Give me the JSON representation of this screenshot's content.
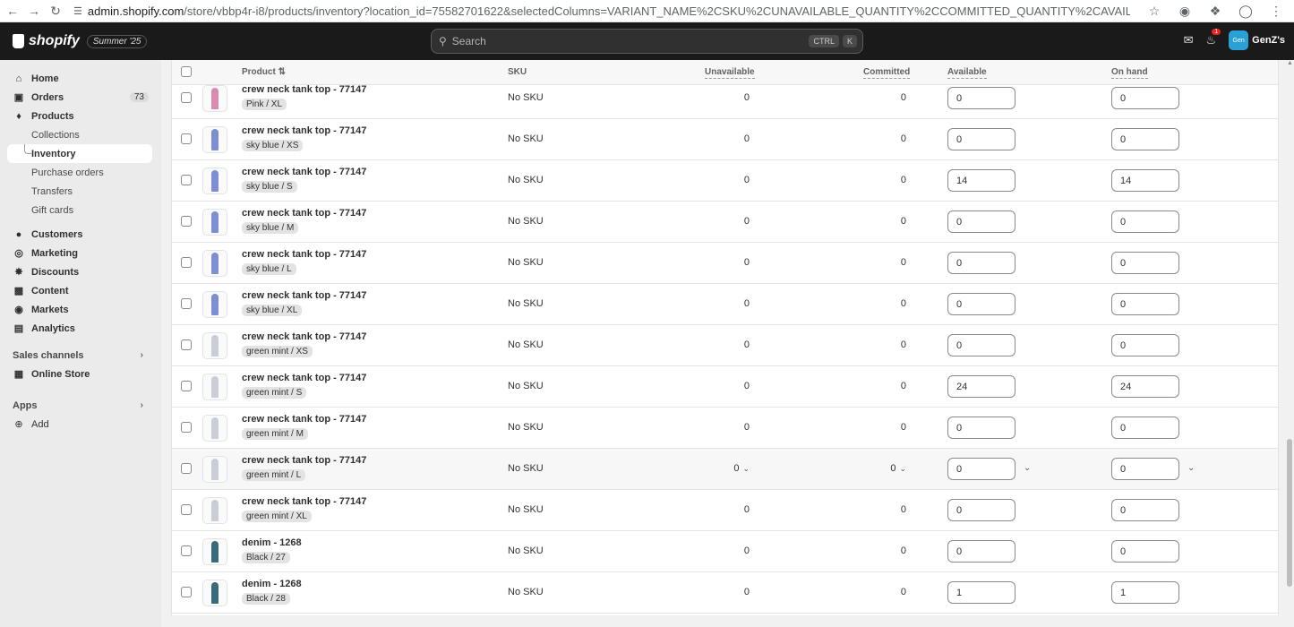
{
  "browser": {
    "url_host": "admin.shopify.com",
    "url_path": "/store/vbbp4r-i8/products/inventory?location_id=75582701622&selectedColumns=VARIANT_NAME%2CSKU%2CUNAVAILABLE_QUANTITY%2CCOMMITTED_QUANTITY%2CAVAILABLE_QUANTITY%2CON_HAND_QUANTITY..."
  },
  "topbar": {
    "brand": "shopify",
    "edition": "Summer '25",
    "search_placeholder": "Search",
    "shortcut_key1": "CTRL",
    "shortcut_key2": "K",
    "notification_count": "1",
    "avatar_initials": "Gen",
    "store_name": "GenZ's"
  },
  "sidebar": {
    "home": "Home",
    "orders": "Orders",
    "orders_count": "73",
    "products": "Products",
    "collections": "Collections",
    "inventory": "Inventory",
    "purchase_orders": "Purchase orders",
    "transfers": "Transfers",
    "gift_cards": "Gift cards",
    "customers": "Customers",
    "marketing": "Marketing",
    "discounts": "Discounts",
    "content": "Content",
    "markets": "Markets",
    "analytics": "Analytics",
    "sales_channels": "Sales channels",
    "online_store": "Online Store",
    "apps": "Apps",
    "add": "Add"
  },
  "table": {
    "headers": {
      "product": "Product",
      "sku": "SKU",
      "unavailable": "Unavailable",
      "committed": "Committed",
      "available": "Available",
      "on_hand": "On hand"
    },
    "rows": [
      {
        "name": "crew neck tank top - 77147",
        "variant": "Pink / XL",
        "sku": "No SKU",
        "unavailable": "0",
        "committed": "0",
        "available": "0",
        "on_hand": "0",
        "color": "#d98bb0"
      },
      {
        "name": "crew neck tank top - 77147",
        "variant": "sky blue / XS",
        "sku": "No SKU",
        "unavailable": "0",
        "committed": "0",
        "available": "0",
        "on_hand": "0",
        "color": "#7b8fd1"
      },
      {
        "name": "crew neck tank top - 77147",
        "variant": "sky blue / S",
        "sku": "No SKU",
        "unavailable": "0",
        "committed": "0",
        "available": "14",
        "on_hand": "14",
        "color": "#7b8fd1"
      },
      {
        "name": "crew neck tank top - 77147",
        "variant": "sky blue / M",
        "sku": "No SKU",
        "unavailable": "0",
        "committed": "0",
        "available": "0",
        "on_hand": "0",
        "color": "#7b8fd1"
      },
      {
        "name": "crew neck tank top - 77147",
        "variant": "sky blue / L",
        "sku": "No SKU",
        "unavailable": "0",
        "committed": "0",
        "available": "0",
        "on_hand": "0",
        "color": "#7b8fd1"
      },
      {
        "name": "crew neck tank top - 77147",
        "variant": "sky blue / XL",
        "sku": "No SKU",
        "unavailable": "0",
        "committed": "0",
        "available": "0",
        "on_hand": "0",
        "color": "#7b8fd1"
      },
      {
        "name": "crew neck tank top - 77147",
        "variant": "green mint / XS",
        "sku": "No SKU",
        "unavailable": "0",
        "committed": "0",
        "available": "0",
        "on_hand": "0",
        "color": "#c9cdd6"
      },
      {
        "name": "crew neck tank top - 77147",
        "variant": "green mint / S",
        "sku": "No SKU",
        "unavailable": "0",
        "committed": "0",
        "available": "24",
        "on_hand": "24",
        "color": "#c9cdd6"
      },
      {
        "name": "crew neck tank top - 77147",
        "variant": "green mint / M",
        "sku": "No SKU",
        "unavailable": "0",
        "committed": "0",
        "available": "0",
        "on_hand": "0",
        "color": "#c9cdd6"
      },
      {
        "name": "crew neck tank top - 77147",
        "variant": "green mint / L",
        "sku": "No SKU",
        "unavailable": "0",
        "committed": "0",
        "available": "0",
        "on_hand": "0",
        "color": "#c9cdd6"
      },
      {
        "name": "crew neck tank top - 77147",
        "variant": "green mint / XL",
        "sku": "No SKU",
        "unavailable": "0",
        "committed": "0",
        "available": "0",
        "on_hand": "0",
        "color": "#c9cdd6"
      },
      {
        "name": "denim - 1268",
        "variant": "Black / 27",
        "sku": "No SKU",
        "unavailable": "0",
        "committed": "0",
        "available": "0",
        "on_hand": "0",
        "color": "#3a6a7a"
      },
      {
        "name": "denim - 1268",
        "variant": "Black / 28",
        "sku": "No SKU",
        "unavailable": "0",
        "committed": "0",
        "available": "1",
        "on_hand": "1",
        "color": "#3a6a7a"
      }
    ]
  }
}
